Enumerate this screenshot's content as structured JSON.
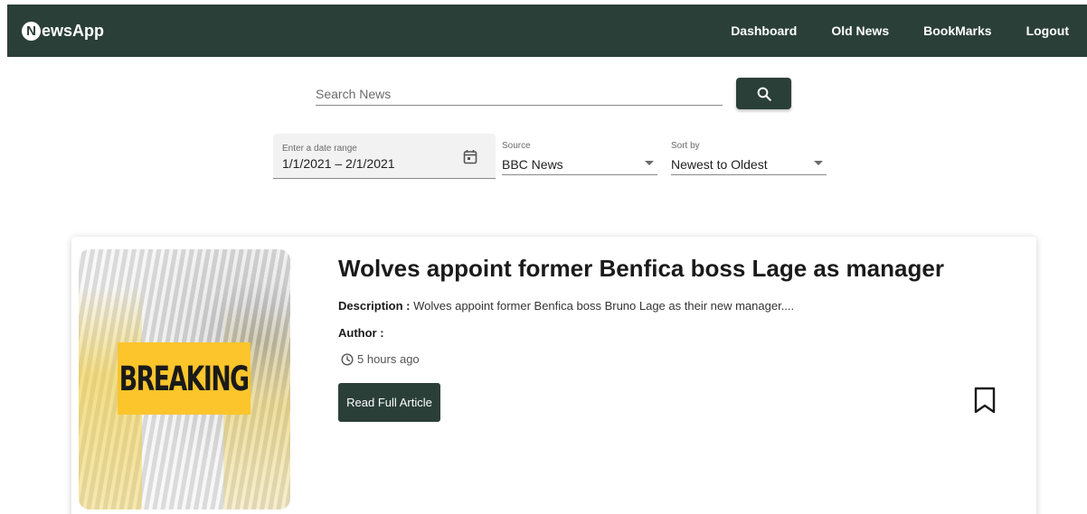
{
  "navbar": {
    "brand_badge": "N",
    "brand_text": "ewsApp",
    "links": [
      "Dashboard",
      "Old News",
      "BookMarks",
      "Logout"
    ],
    "color": "#2b3f39"
  },
  "search": {
    "placeholder": "Search News",
    "button_icon": "search-icon"
  },
  "filters": {
    "date": {
      "label": "Enter a date range",
      "value": "1/1/2021 – 2/1/2021",
      "icon": "calendar-icon"
    },
    "source": {
      "label": "Source",
      "value": "BBC News"
    },
    "sort": {
      "label": "Sort by",
      "value": "Newest to Oldest"
    }
  },
  "article": {
    "image_text": "BREAKING",
    "title": "Wolves appoint former Benfica boss Lage as manager",
    "description_label": "Description :",
    "description": "Wolves appoint former Benfica boss Bruno Lage as their new manager....",
    "author_label": "Author :",
    "time": "5 hours ago",
    "read_button": "Read Full Article",
    "bookmark_icon": "bookmark-icon"
  }
}
